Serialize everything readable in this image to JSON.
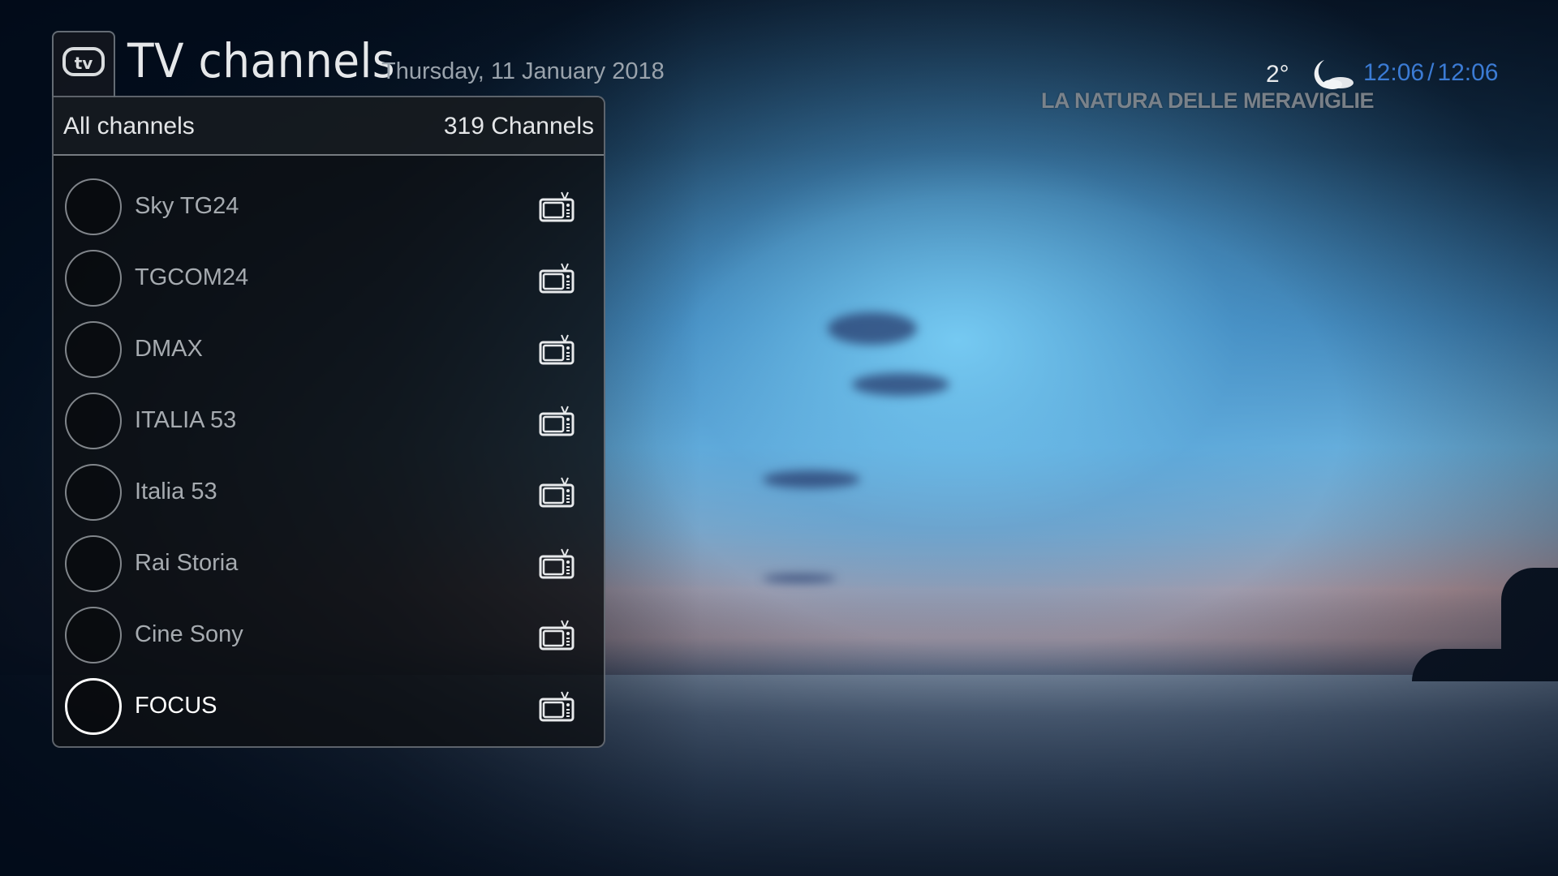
{
  "header": {
    "title": "TV channels",
    "date": "Thursday, 11 January 2018",
    "logo_icon": "tv-logo-icon"
  },
  "status": {
    "temperature": "2°",
    "weather_icon": "moon-icon",
    "time_current": "12:06",
    "time_separator": "/",
    "time_end": "12:06",
    "time_color": "#3b7bd4"
  },
  "now_playing": {
    "program_title": "LA NATURA DELLE MERAVIGLIE"
  },
  "panel": {
    "group_label": "All channels",
    "channel_count": "319 Channels",
    "channels": [
      {
        "name": "Sky TG24",
        "type_icon": "tv-set-icon",
        "selected": false
      },
      {
        "name": "TGCOM24",
        "type_icon": "tv-set-icon",
        "selected": false
      },
      {
        "name": "DMAX",
        "type_icon": "tv-set-icon",
        "selected": false
      },
      {
        "name": "ITALIA 53",
        "type_icon": "tv-set-icon",
        "selected": false
      },
      {
        "name": "Italia 53",
        "type_icon": "tv-set-icon",
        "selected": false
      },
      {
        "name": "Rai Storia",
        "type_icon": "tv-set-icon",
        "selected": false
      },
      {
        "name": "Cine Sony",
        "type_icon": "tv-set-icon",
        "selected": false
      },
      {
        "name": "FOCUS",
        "type_icon": "tv-set-icon",
        "selected": true
      }
    ]
  }
}
